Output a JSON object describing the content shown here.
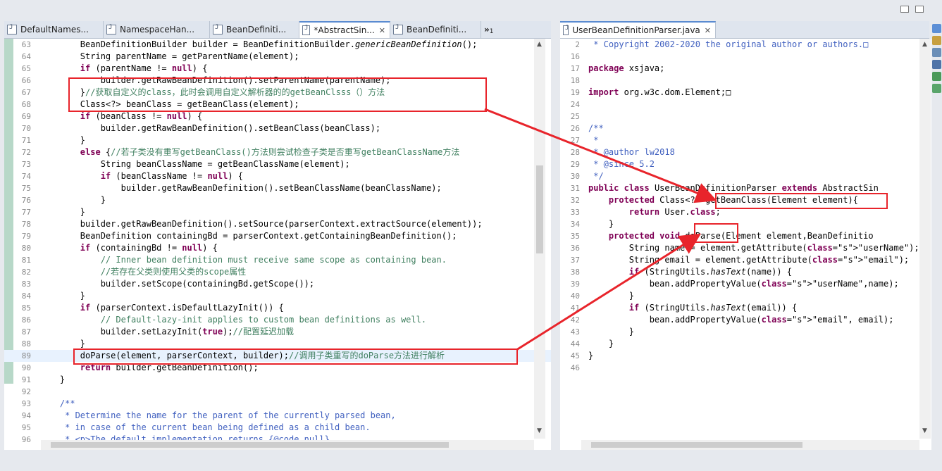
{
  "left_tabs": [
    {
      "label": "DefaultNames...",
      "active": false
    },
    {
      "label": "NamespaceHan...",
      "active": false
    },
    {
      "label": "BeanDefiniti...",
      "active": false
    },
    {
      "label": "*AbstractSin...",
      "active": true,
      "close": "✕"
    },
    {
      "label": "BeanDefiniti...",
      "active": false
    }
  ],
  "overflow_tabs": "»",
  "overflow_count": "1",
  "right_tab": {
    "label": "UserBeanDefinitionParser.java",
    "close": "✕"
  },
  "colors": {
    "accent": "#5a8bd1",
    "annotation_red": "#e8242b",
    "keyword": "#7f0055",
    "comment": "#3f7f5f",
    "javadoc": "#3f5fbf",
    "string": "#2a00ff"
  },
  "left_lines": [
    {
      "n": "63",
      "t": "        BeanDefinitionBuilder builder = BeanDefinitionBuilder.genericBeanDefinition();"
    },
    {
      "n": "64",
      "t": "        String parentName = getParentName(element);"
    },
    {
      "n": "65",
      "t": "        if (parentName != null) {"
    },
    {
      "n": "66",
      "t": "            builder.getRawBeanDefinition().setParentName(parentName);"
    },
    {
      "n": "67",
      "t": "        }//获取自定义的class，此时会调用自定义解析器的的getBeanClsss（）方法"
    },
    {
      "n": "68",
      "t": "        Class<?> beanClass = getBeanClass(element);"
    },
    {
      "n": "69",
      "t": "        if (beanClass != null) {"
    },
    {
      "n": "70",
      "t": "            builder.getRawBeanDefinition().setBeanClass(beanClass);"
    },
    {
      "n": "71",
      "t": "        }"
    },
    {
      "n": "72",
      "t": "        else {//若子类没有重写getBeanClass()方法则尝试检查子类是否重写getBeanClassName方法"
    },
    {
      "n": "73",
      "t": "            String beanClassName = getBeanClassName(element);"
    },
    {
      "n": "74",
      "t": "            if (beanClassName != null) {"
    },
    {
      "n": "75",
      "t": "                builder.getRawBeanDefinition().setBeanClassName(beanClassName);"
    },
    {
      "n": "76",
      "t": "            }"
    },
    {
      "n": "77",
      "t": "        }"
    },
    {
      "n": "78",
      "t": "        builder.getRawBeanDefinition().setSource(parserContext.extractSource(element));"
    },
    {
      "n": "79",
      "t": "        BeanDefinition containingBd = parserContext.getContainingBeanDefinition();"
    },
    {
      "n": "80",
      "t": "        if (containingBd != null) {"
    },
    {
      "n": "81",
      "t": "            // Inner bean definition must receive same scope as containing bean."
    },
    {
      "n": "82",
      "t": "            //若存在父类则使用父类的scope属性"
    },
    {
      "n": "83",
      "t": "            builder.setScope(containingBd.getScope());"
    },
    {
      "n": "84",
      "t": "        }"
    },
    {
      "n": "85",
      "t": "        if (parserContext.isDefaultLazyInit()) {"
    },
    {
      "n": "86",
      "t": "            // Default-lazy-init applies to custom bean definitions as well."
    },
    {
      "n": "87",
      "t": "            builder.setLazyInit(true);//配置延迟加载"
    },
    {
      "n": "88",
      "t": "        }"
    },
    {
      "n": "89",
      "t": "        doParse(element, parserContext, builder);//调用子类重写的doParse方法进行解析"
    },
    {
      "n": "90",
      "t": "        return builder.getBeanDefinition();"
    },
    {
      "n": "91",
      "t": "    }"
    },
    {
      "n": "92",
      "t": ""
    },
    {
      "n": "93",
      "t": "    /**"
    },
    {
      "n": "94",
      "t": "     * Determine the name for the parent of the currently parsed bean,"
    },
    {
      "n": "95",
      "t": "     * in case of the current bean being defined as a child bean."
    },
    {
      "n": "96",
      "t": "     * <p>The default implementation returns {@code null},"
    }
  ],
  "right_lines": [
    {
      "n": "2",
      "t": " * Copyright 2002-2020 the original author or authors.□"
    },
    {
      "n": "16",
      "t": ""
    },
    {
      "n": "17",
      "t": "package xsjava;"
    },
    {
      "n": "18",
      "t": ""
    },
    {
      "n": "19",
      "t": "import org.w3c.dom.Element;□"
    },
    {
      "n": "24",
      "t": ""
    },
    {
      "n": "25",
      "t": ""
    },
    {
      "n": "26",
      "t": "/**"
    },
    {
      "n": "27",
      "t": " *"
    },
    {
      "n": "28",
      "t": " * @author lw2018"
    },
    {
      "n": "29",
      "t": " * @since 5.2"
    },
    {
      "n": "30",
      "t": " */"
    },
    {
      "n": "31",
      "t": "public class UserBeanDefinitionParser extends AbstractSin"
    },
    {
      "n": "32",
      "t": "    protected Class<?> getBeanClass(Element element){"
    },
    {
      "n": "33",
      "t": "        return User.class;"
    },
    {
      "n": "34",
      "t": "    }"
    },
    {
      "n": "35",
      "t": "    protected void doParse(Element element,BeanDefinitio"
    },
    {
      "n": "36",
      "t": "        String name = element.getAttribute(\"userName\");"
    },
    {
      "n": "37",
      "t": "        String email = element.getAttribute(\"email\");"
    },
    {
      "n": "38",
      "t": "        if (StringUtils.hasText(name)) {"
    },
    {
      "n": "39",
      "t": "            bean.addPropertyValue(\"userName\",name);"
    },
    {
      "n": "40",
      "t": "        }"
    },
    {
      "n": "41",
      "t": "        if (StringUtils.hasText(email)) {"
    },
    {
      "n": "42",
      "t": "            bean.addPropertyValue(\"email\", email);"
    },
    {
      "n": "43",
      "t": "        }"
    },
    {
      "n": "44",
      "t": "    }"
    },
    {
      "n": "45",
      "t": "}"
    },
    {
      "n": "46",
      "t": ""
    }
  ]
}
